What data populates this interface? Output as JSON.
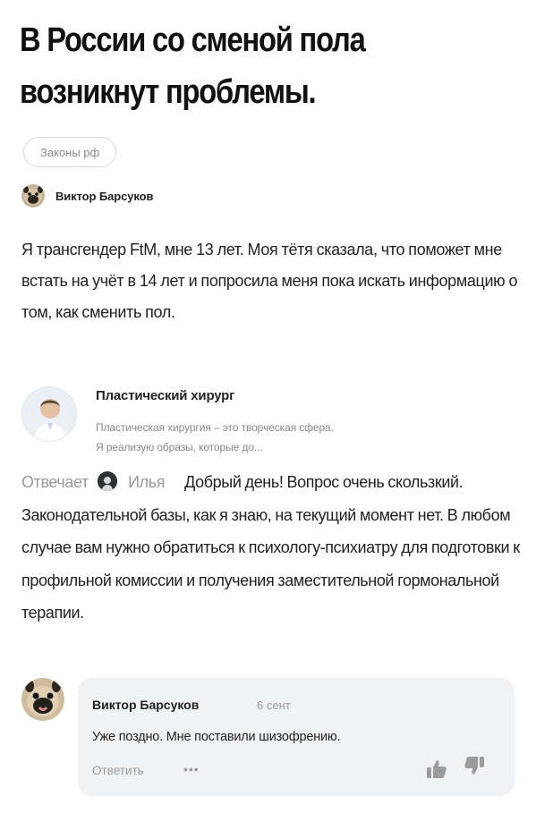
{
  "meme": {
    "title": "В России со сменой пола возникнут проблемы."
  },
  "post": {
    "category": "Законы рф",
    "author_name": "Виктор Барсуков",
    "question": "Я трансгендер FtM, мне 13 лет. Моя тётя сказала, что поможет мне встать на учёт в 14 лет и попросила меня пока искать информацию о том, как сменить пол."
  },
  "expert": {
    "name": "Пластический хирург",
    "description_line1": "Пластическая хирургия – это творческая сфера.",
    "description_line2": "Я реализую образы, которые до..."
  },
  "answer": {
    "prefix": "Отвечает",
    "responder_name": "Илья",
    "text": "Добрый день! Вопрос очень скользкий. Законодательной базы, как я знаю, на текущий момент нет. В любом случае вам нужно обратиться к психологу-психиатру для подготовки к профильной комиссии и получения заместительной гормональной терапии."
  },
  "comment": {
    "author_name": "Виктор Барсуков",
    "date": "6 сент",
    "text": "Уже поздно. Мне поставили шизофрению.",
    "reply_label": "Ответить",
    "more_label": "•••"
  },
  "icons": {
    "small_avatar": "pug-avatar-icon",
    "expert_avatar": "doctor-avatar-icon",
    "responder_avatar": "ilya-avatar-icon",
    "comment_avatar": "pug-avatar-icon",
    "like": "thumbs-up-icon",
    "dislike": "thumbs-down-icon",
    "more": "ellipsis-icon"
  }
}
